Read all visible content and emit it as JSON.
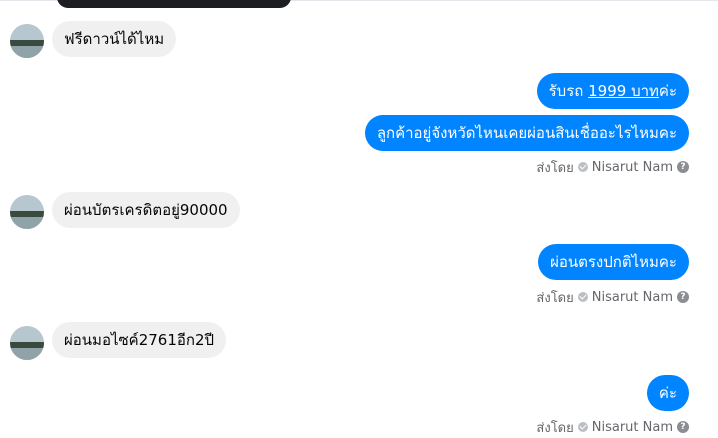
{
  "messages": {
    "m1": "ฟรีดาวน์ได้ไหม",
    "m2_prefix": "รับรถ ",
    "m2_link": "1999 บาท",
    "m2_suffix": "ค่ะ",
    "m3": "ลูกค้าอยู่จังหวัดไหนเคยผ่อนสินเชื่ออะไรไหมคะ",
    "m4": "ผ่อนบัตรเครดิตอยู่90000",
    "m5": "ผ่อนตรงปกติไหมคะ",
    "m6": "ผ่อนมอไซค์2761อีก2ปี",
    "m7": "ค่ะ"
  },
  "receipt": {
    "sent_by": "ส่งโดย",
    "sender": "Nisarut Nam",
    "help": "?"
  },
  "colors": {
    "outgoing": "#0084ff",
    "incoming": "#f0f0f0",
    "meta": "#65676b"
  },
  "icons": {
    "status": "sent-check-icon",
    "help": "question-icon"
  }
}
